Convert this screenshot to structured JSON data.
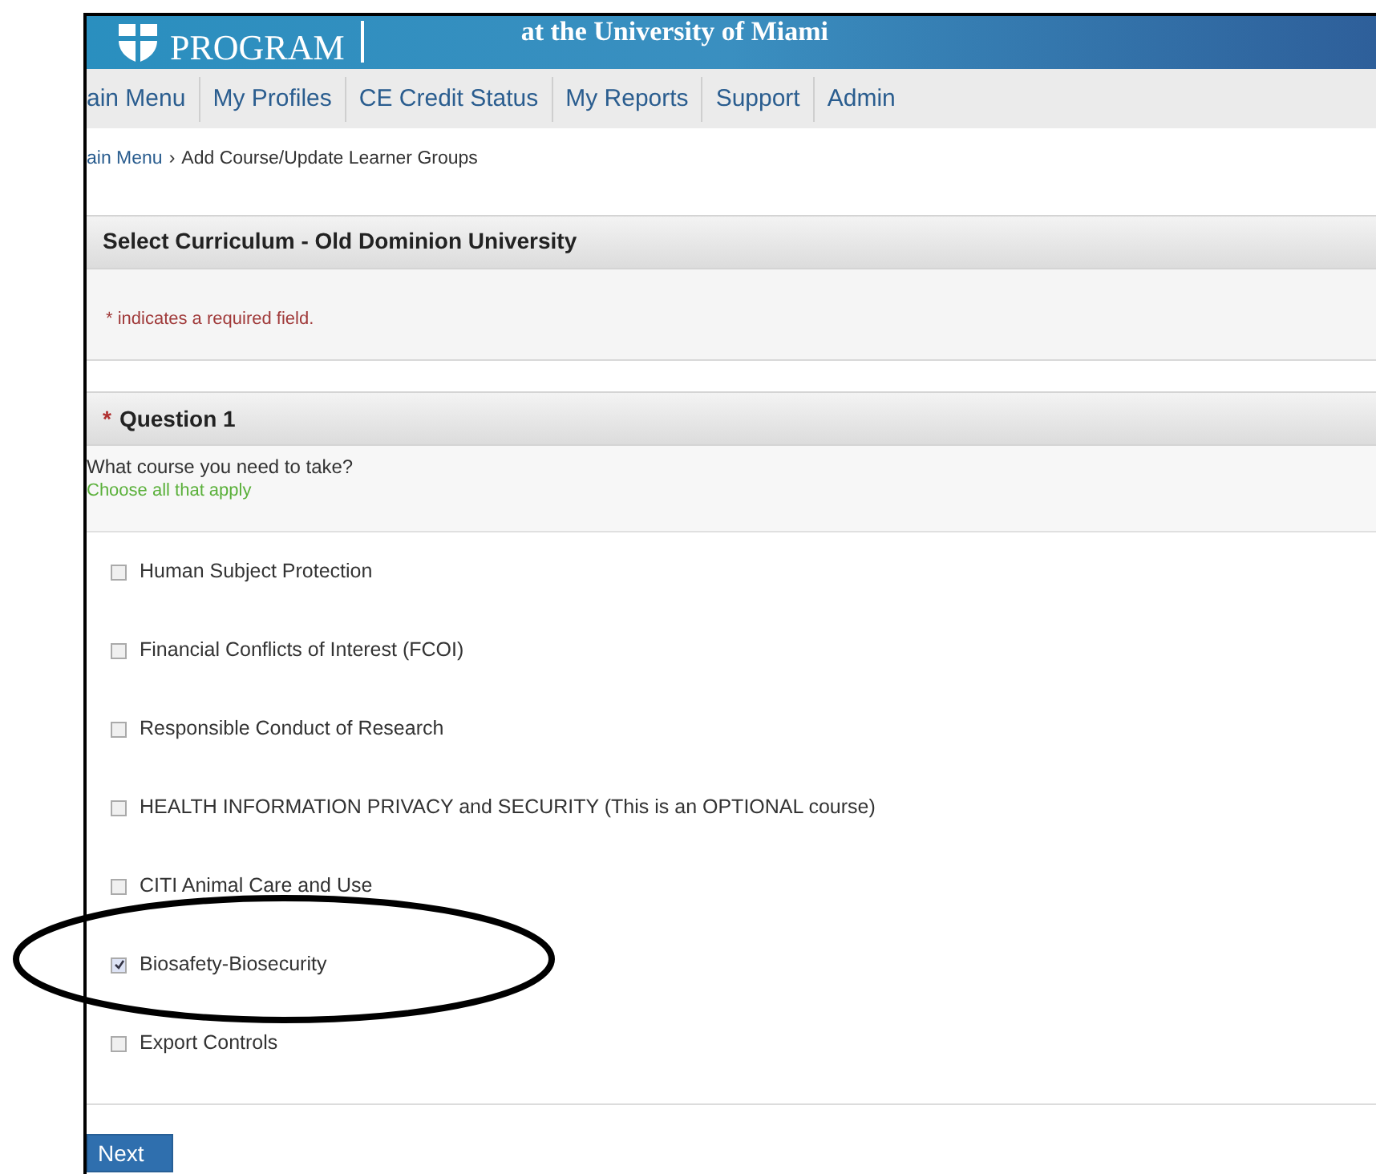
{
  "banner": {
    "logo_text": "PROGRAM",
    "subtitle": "at the University of Miami"
  },
  "nav": [
    {
      "label": "ain Menu"
    },
    {
      "label": "My Profiles"
    },
    {
      "label": "CE Credit Status"
    },
    {
      "label": "My Reports"
    },
    {
      "label": "Support"
    },
    {
      "label": "Admin"
    }
  ],
  "breadcrumb": {
    "items": [
      {
        "label": "ain Menu",
        "kind": "link"
      },
      {
        "label": "Add Course/Update Learner Groups",
        "kind": "current"
      }
    ],
    "separator": "›"
  },
  "curriculum": {
    "title": "Select Curriculum - Old Dominion University",
    "required_note": "* indicates a required field."
  },
  "question": {
    "marker": "*",
    "title": "Question 1",
    "prompt": "What course you need to take?",
    "hint": "Choose all that apply",
    "options": [
      {
        "label": "Human Subject Protection",
        "checked": false
      },
      {
        "label": "Financial Conflicts of Interest (FCOI)",
        "checked": false
      },
      {
        "label": "Responsible Conduct of Research",
        "checked": false
      },
      {
        "label": "HEALTH INFORMATION PRIVACY and SECURITY (This is an OPTIONAL course)",
        "checked": false
      },
      {
        "label": "CITI Animal Care and Use",
        "checked": false
      },
      {
        "label": "Biosafety-Biosecurity",
        "checked": true
      },
      {
        "label": "Export Controls",
        "checked": false
      }
    ]
  },
  "next_button": "Next"
}
